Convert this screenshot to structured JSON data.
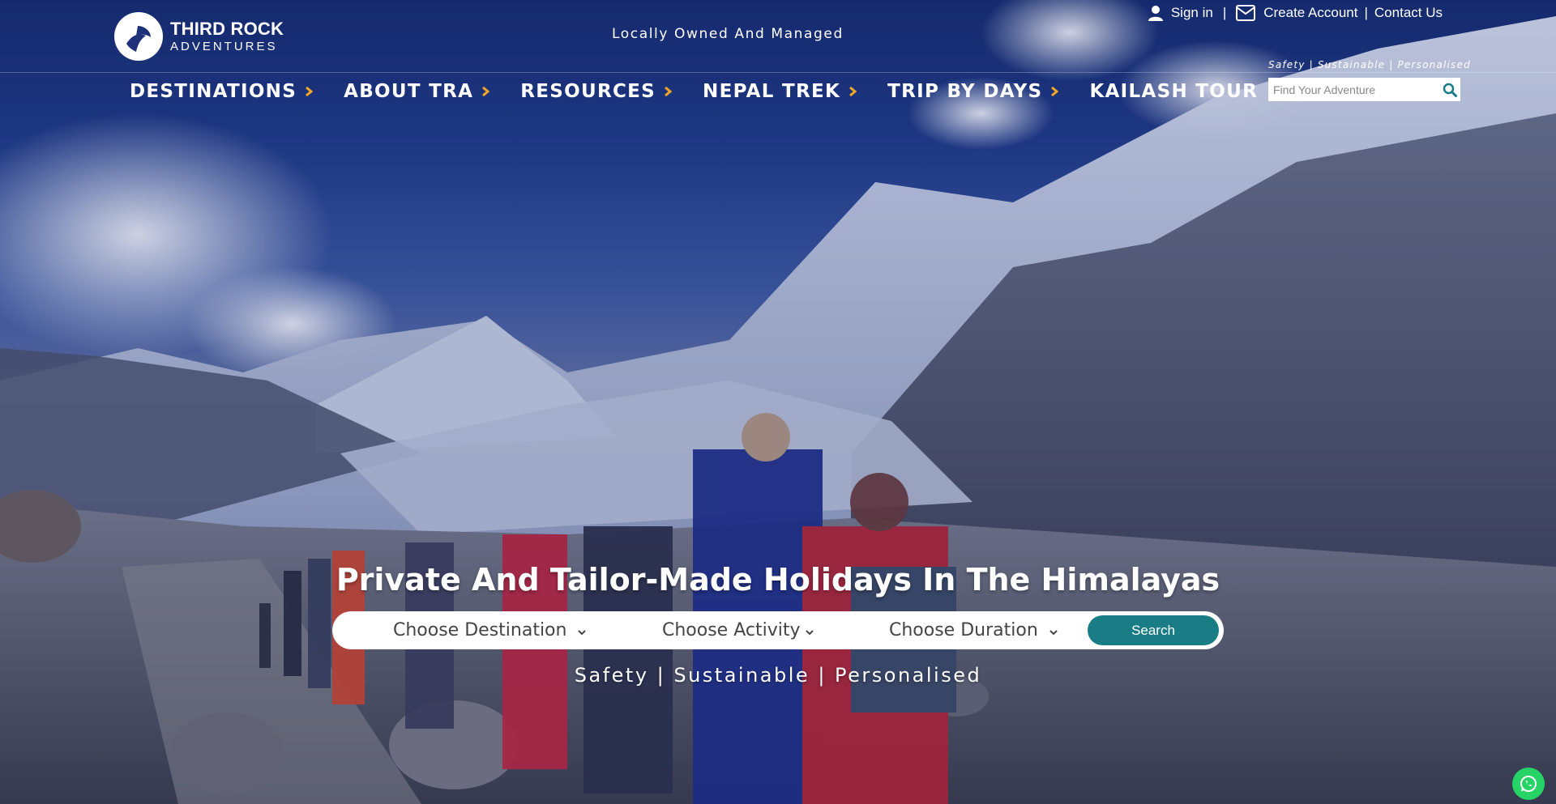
{
  "brand": {
    "name": "THIRD ROCK",
    "subtitle": "ADVENTURES"
  },
  "header": {
    "tagline": "Locally Owned And Managed",
    "links": {
      "sign_in": "Sign in",
      "separator": "|",
      "create_account": "Create Account",
      "contact_us": "Contact Us"
    },
    "search": {
      "tagline": "Safety | Sustainable | Personalised",
      "placeholder": "Find Your Adventure"
    }
  },
  "nav": {
    "items": [
      {
        "label": "DESTINATIONS"
      },
      {
        "label": "ABOUT TRA"
      },
      {
        "label": "RESOURCES"
      },
      {
        "label": "NEPAL TREK"
      },
      {
        "label": "TRIP BY DAYS"
      },
      {
        "label": "KAILASH TOUR"
      }
    ]
  },
  "hero": {
    "headline": "Private And Tailor-Made Holidays In The Himalayas",
    "tagline": "Safety | Sustainable | Personalised",
    "search": {
      "destination": "Choose Destination",
      "activity": "Choose Activity",
      "duration": "Choose Duration",
      "button": "Search"
    }
  },
  "colors": {
    "accent_chevron": "#f2a623",
    "search_button": "#1a7d86",
    "whatsapp": "#25d366"
  },
  "icons": {
    "user": "user-icon",
    "envelope": "envelope-icon",
    "search": "search-icon",
    "whatsapp": "whatsapp-icon"
  }
}
